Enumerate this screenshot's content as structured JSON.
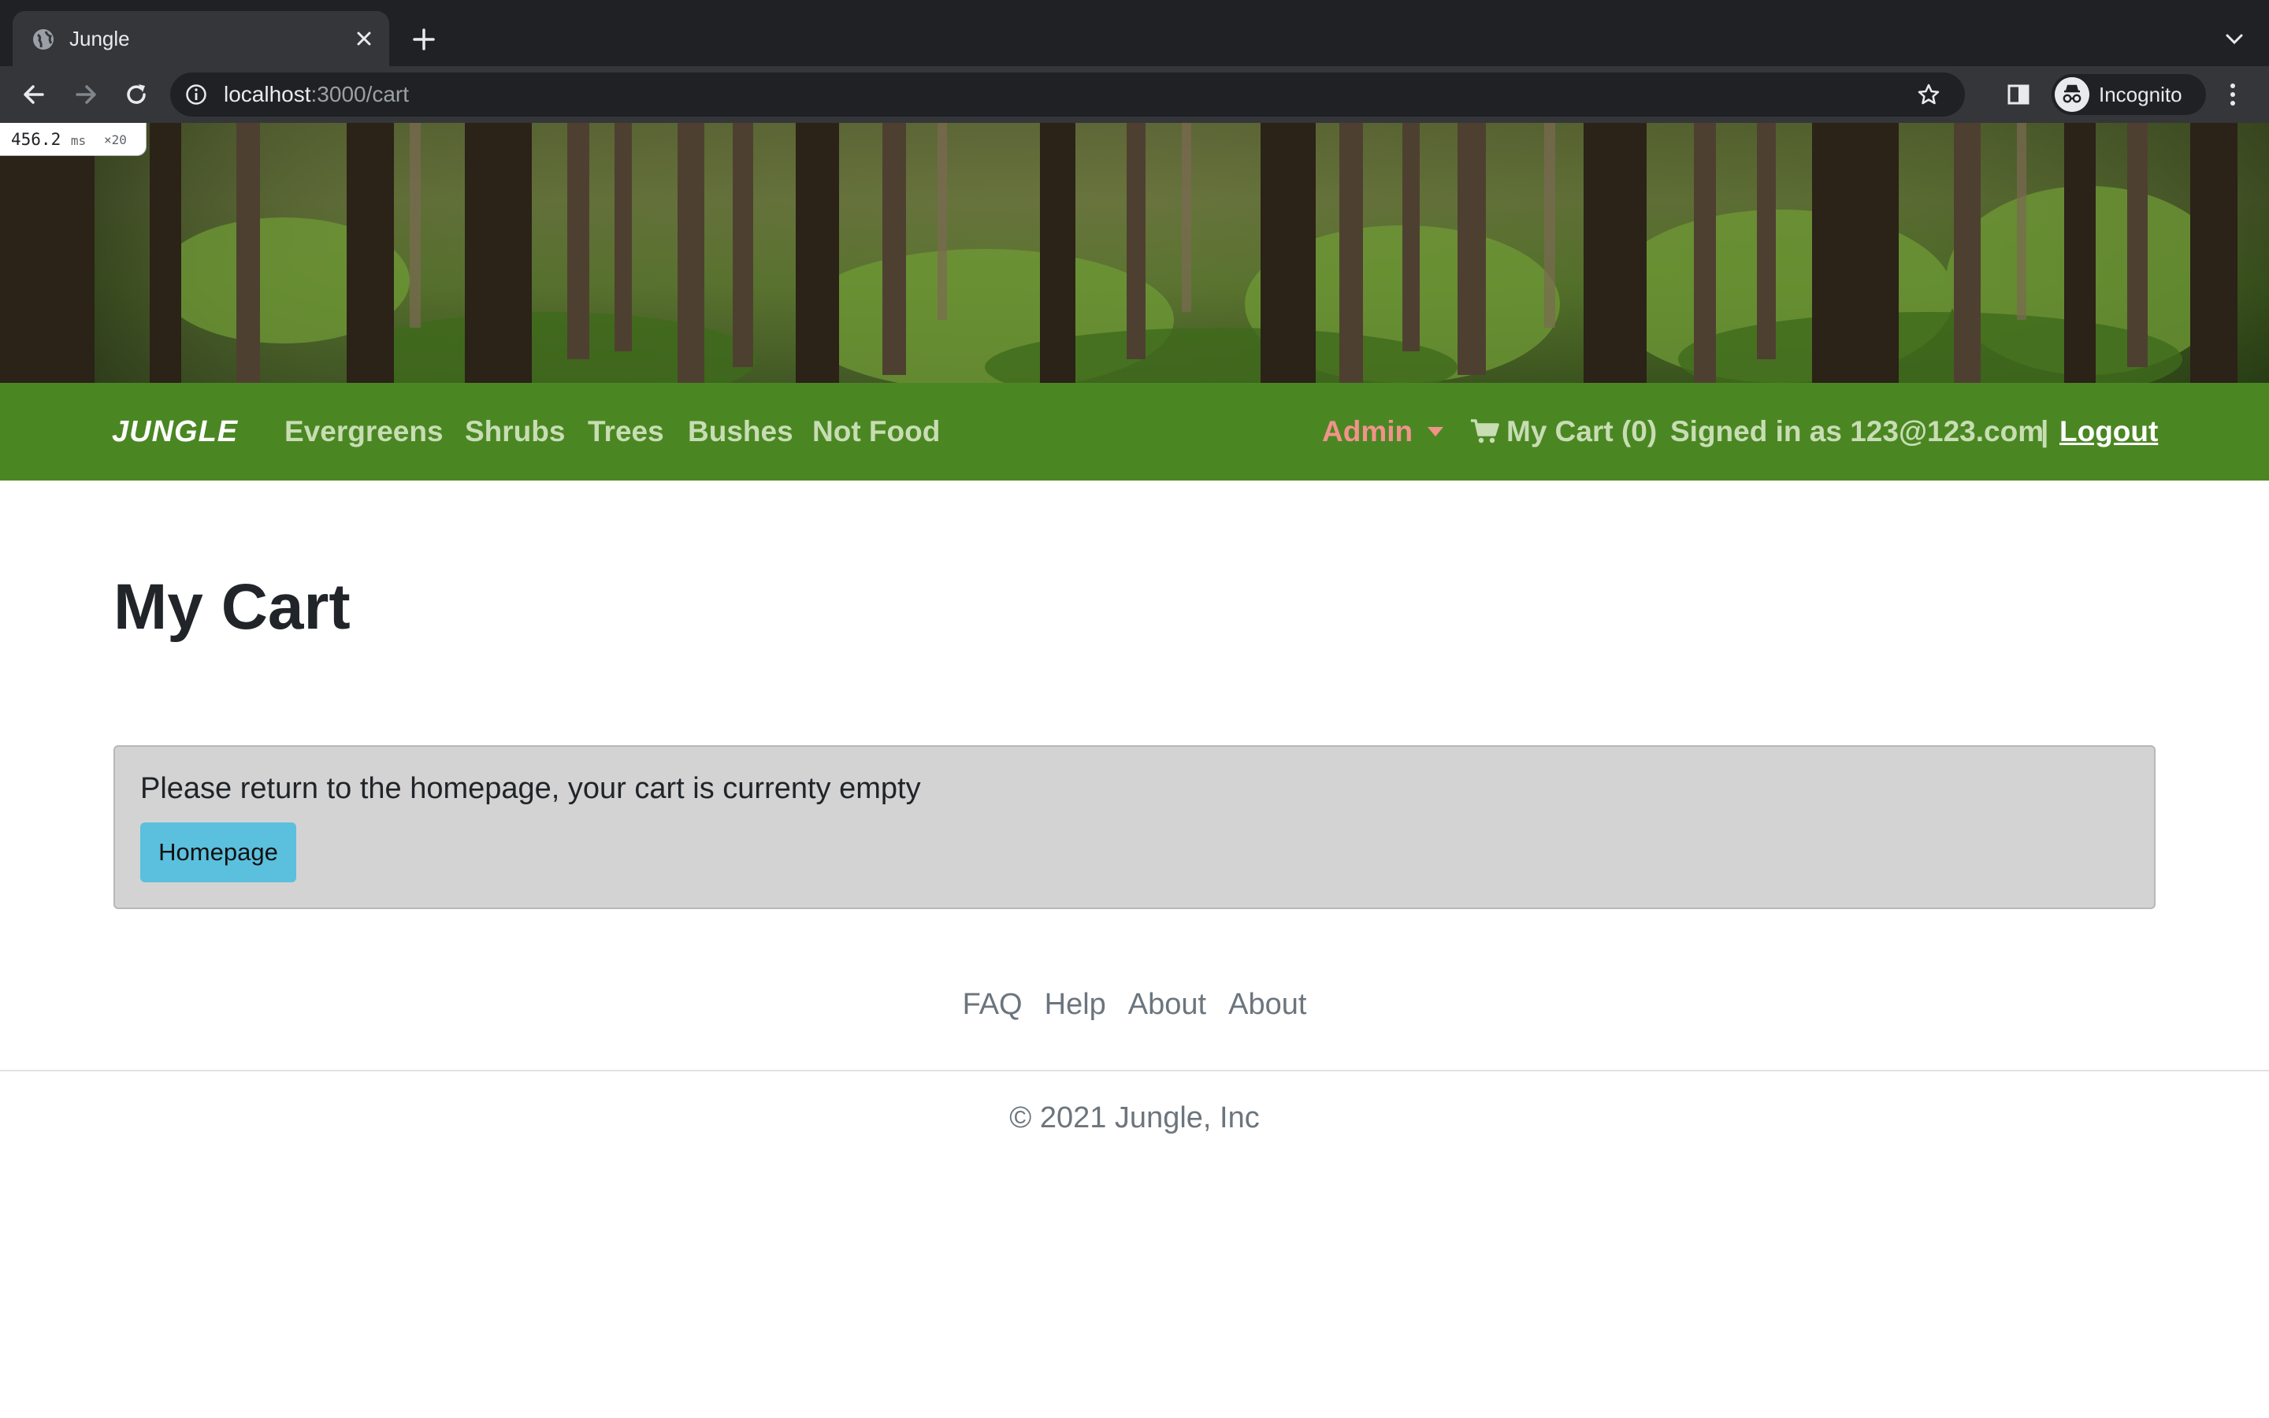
{
  "browser": {
    "tab_title": "Jungle",
    "url_host": "localhost",
    "url_path": ":3000/cart",
    "profile_label": "Incognito",
    "icons": [
      "globe-icon",
      "close-icon",
      "plus-icon",
      "chevron-down-icon",
      "back-arrow-icon",
      "forward-arrow-icon",
      "reload-icon",
      "info-icon",
      "star-icon",
      "side-panel-icon",
      "incognito-icon",
      "kebab-menu-icon"
    ]
  },
  "perf_overlay": {
    "value": "456.2",
    "unit": "ms",
    "multiplier": "×20"
  },
  "navbar": {
    "brand": "JUNGLE",
    "links": [
      "Evergreens",
      "Shrubs",
      "Trees",
      "Bushes",
      "Not Food"
    ],
    "admin_label": "Admin",
    "cart_label": "My Cart (0)",
    "signed_in_text": "Signed in as 123@123.com",
    "separator": "|",
    "logout_label": "Logout",
    "colors": {
      "bar": "#4a8723",
      "link": "#c8ddb3",
      "admin": "#f0938a"
    }
  },
  "main": {
    "title": "My Cart",
    "empty_message": "Please return to the homepage, your cart is currenty empty",
    "homepage_button": "Homepage",
    "button_color": "#5bc0de"
  },
  "footer": {
    "links": [
      "FAQ",
      "Help",
      "About",
      "About"
    ],
    "copyright": "© 2021 Jungle, Inc"
  }
}
